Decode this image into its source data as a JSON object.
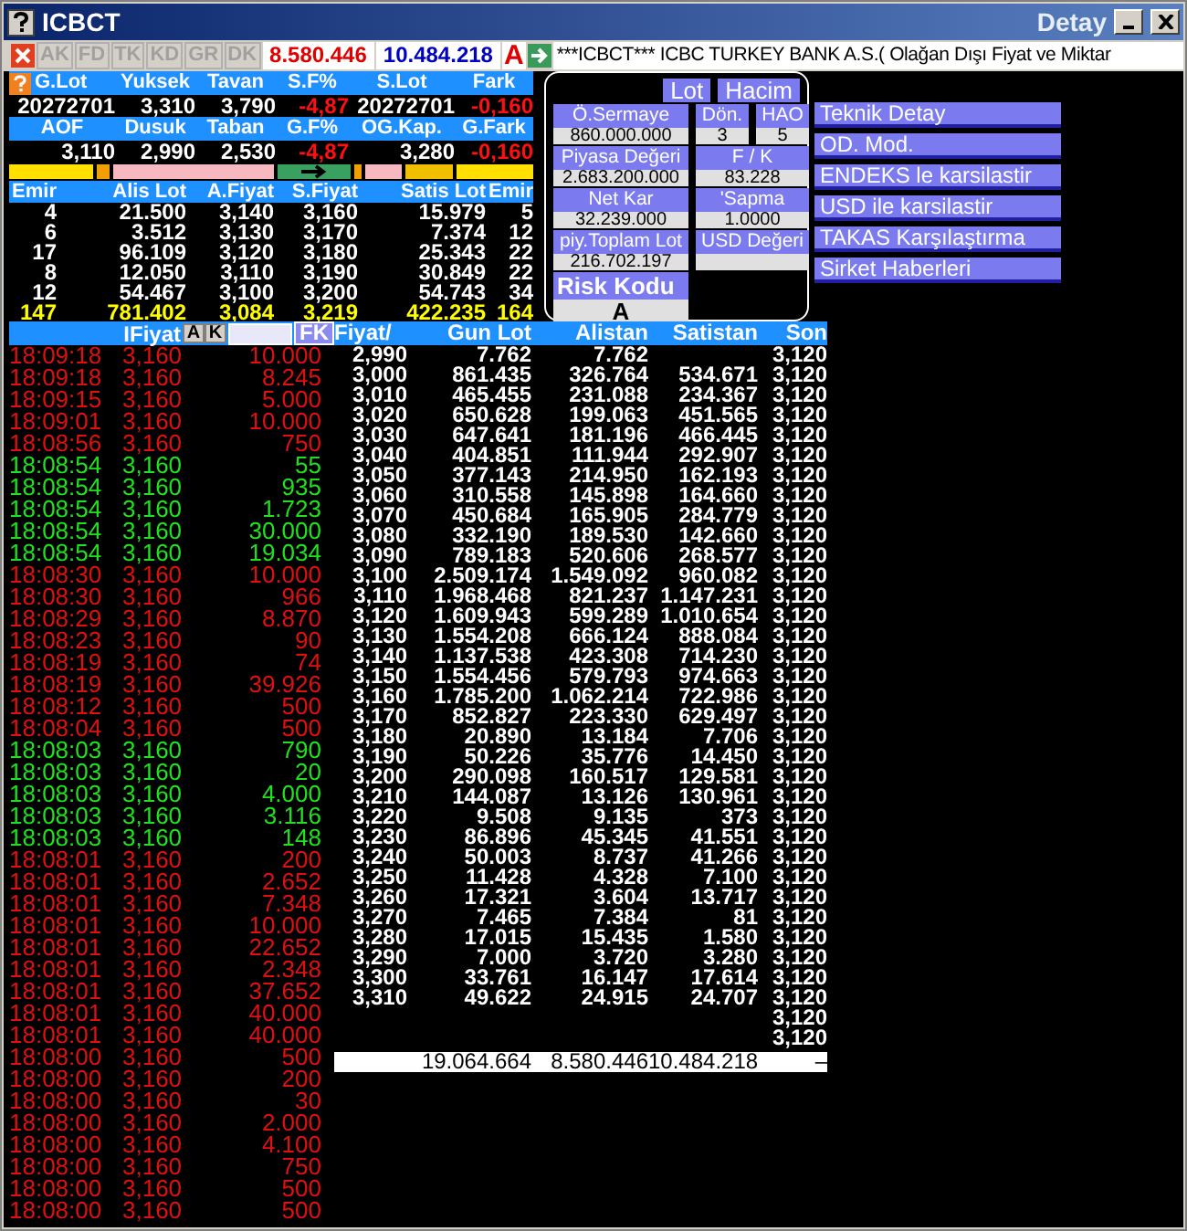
{
  "window": {
    "title": "ICBCT",
    "detail_label": "Detay"
  },
  "toolbar": {
    "buttons": [
      {
        "label": "AK",
        "disabled": true
      },
      {
        "label": "FD",
        "disabled": true
      },
      {
        "label": "TK",
        "disabled": true
      },
      {
        "label": "KD",
        "disabled": true
      },
      {
        "label": "GR",
        "disabled": true
      },
      {
        "label": "DK",
        "disabled": true
      }
    ],
    "bid_total": "8.580.446",
    "ask_total": "10.484.218",
    "flag": "A",
    "ticker": "***ICBCT*** ICBC TURKEY BANK A.S.( Olağan Dışı Fiyat ve Miktar"
  },
  "summary": [
    {
      "columns": [
        "G.Lot",
        "Yuksek",
        "Tavan",
        "S.F%",
        "S.Lot",
        "Fark"
      ],
      "values": [
        {
          "text": "20272701",
          "negative": false
        },
        {
          "text": "3,310",
          "negative": false
        },
        {
          "text": "3,790",
          "negative": false
        },
        {
          "text": "-4,87",
          "negative": true
        },
        {
          "text": "20272701",
          "negative": false
        },
        {
          "text": "-0,160",
          "negative": true
        }
      ]
    },
    {
      "columns": [
        "AOF",
        "Dusuk",
        "Taban",
        "G.F%",
        "OG.Kap.",
        "G.Fark"
      ],
      "values": [
        {
          "text": "3,110",
          "negative": false
        },
        {
          "text": "2,990",
          "negative": false
        },
        {
          "text": "2,530",
          "negative": false
        },
        {
          "text": "-4,87",
          "negative": true
        },
        {
          "text": "3,280",
          "negative": false
        },
        {
          "text": "-0,160",
          "negative": true
        }
      ]
    }
  ],
  "order_book": {
    "columns": [
      "Emir",
      "Alis Lot",
      "A.Fiyat",
      "S.Fiyat",
      "Satis Lot",
      "Emir"
    ],
    "rows": [
      [
        "4",
        "21.500",
        "3,140",
        "3,160",
        "15.979",
        "5"
      ],
      [
        "6",
        "3.512",
        "3,130",
        "3,170",
        "7.374",
        "12"
      ],
      [
        "17",
        "96.109",
        "3,120",
        "3,180",
        "25.343",
        "22"
      ],
      [
        "8",
        "12.050",
        "3,110",
        "3,190",
        "30.849",
        "22"
      ],
      [
        "12",
        "54.467",
        "3,100",
        "3,200",
        "54.743",
        "34"
      ]
    ],
    "totals": [
      "147",
      "781.402",
      "3,084",
      "3,219",
      "422.235",
      "164"
    ]
  },
  "info_panel": {
    "mode_buttons": [
      "Lot",
      "Hacim"
    ],
    "fields": [
      {
        "label": "Ö.Sermaye",
        "value": "860.000.000",
        "kind": "wide"
      },
      {
        "label": "Dön.",
        "value": "3",
        "kind": "narrow"
      },
      {
        "label": "HAO",
        "value": "5",
        "kind": "narrow"
      },
      {
        "label": "Piyasa Değeri",
        "value": "2.683.200.000",
        "kind": "wide"
      },
      {
        "label": "F / K",
        "value": "83.228",
        "kind": "pair"
      },
      {
        "label": "Net Kar",
        "value": "32.239.000",
        "kind": "wide"
      },
      {
        "label": "'Sapma",
        "value": "1.0000",
        "kind": "pair"
      },
      {
        "label": "piy.Toplam Lot",
        "value": "216.702.197",
        "kind": "wide"
      },
      {
        "label": "USD Değeri",
        "kind": "pair"
      }
    ],
    "risk": {
      "label": "Risk Kodu",
      "value": "A"
    }
  },
  "actions": [
    "Teknik Detay",
    "OD. Mod.",
    "ENDEKS le karsilastir",
    "USD ile karsilastir",
    "TAKAS Karşılaştırma",
    "Sirket Haberleri"
  ],
  "trades": {
    "header": "IFiyat",
    "buttons": [
      "A",
      "K"
    ],
    "fk_label": "FK",
    "rows": [
      {
        "time": "18:09:18",
        "price": "3,160",
        "lot": "10.000",
        "buy": false
      },
      {
        "time": "18:09:18",
        "price": "3,160",
        "lot": "8.245",
        "buy": false
      },
      {
        "time": "18:09:15",
        "price": "3,160",
        "lot": "5.000",
        "buy": false
      },
      {
        "time": "18:09:01",
        "price": "3,160",
        "lot": "10.000",
        "buy": false
      },
      {
        "time": "18:08:56",
        "price": "3,160",
        "lot": "750",
        "buy": false
      },
      {
        "time": "18:08:54",
        "price": "3,160",
        "lot": "55",
        "buy": true
      },
      {
        "time": "18:08:54",
        "price": "3,160",
        "lot": "935",
        "buy": true
      },
      {
        "time": "18:08:54",
        "price": "3,160",
        "lot": "1.723",
        "buy": true
      },
      {
        "time": "18:08:54",
        "price": "3,160",
        "lot": "30.000",
        "buy": true
      },
      {
        "time": "18:08:54",
        "price": "3,160",
        "lot": "19.034",
        "buy": true
      },
      {
        "time": "18:08:30",
        "price": "3,160",
        "lot": "10.000",
        "buy": false
      },
      {
        "time": "18:08:30",
        "price": "3,160",
        "lot": "966",
        "buy": false
      },
      {
        "time": "18:08:29",
        "price": "3,160",
        "lot": "8.870",
        "buy": false
      },
      {
        "time": "18:08:23",
        "price": "3,160",
        "lot": "90",
        "buy": false
      },
      {
        "time": "18:08:19",
        "price": "3,160",
        "lot": "74",
        "buy": false
      },
      {
        "time": "18:08:19",
        "price": "3,160",
        "lot": "39.926",
        "buy": false
      },
      {
        "time": "18:08:12",
        "price": "3,160",
        "lot": "500",
        "buy": false
      },
      {
        "time": "18:08:04",
        "price": "3,160",
        "lot": "500",
        "buy": false
      },
      {
        "time": "18:08:03",
        "price": "3,160",
        "lot": "790",
        "buy": true
      },
      {
        "time": "18:08:03",
        "price": "3,160",
        "lot": "20",
        "buy": true
      },
      {
        "time": "18:08:03",
        "price": "3,160",
        "lot": "4.000",
        "buy": true
      },
      {
        "time": "18:08:03",
        "price": "3,160",
        "lot": "3.116",
        "buy": true
      },
      {
        "time": "18:08:03",
        "price": "3,160",
        "lot": "148",
        "buy": true
      },
      {
        "time": "18:08:01",
        "price": "3,160",
        "lot": "200",
        "buy": false
      },
      {
        "time": "18:08:01",
        "price": "3,160",
        "lot": "2.652",
        "buy": false
      },
      {
        "time": "18:08:01",
        "price": "3,160",
        "lot": "7.348",
        "buy": false
      },
      {
        "time": "18:08:01",
        "price": "3,160",
        "lot": "10.000",
        "buy": false
      },
      {
        "time": "18:08:01",
        "price": "3,160",
        "lot": "22.652",
        "buy": false
      },
      {
        "time": "18:08:01",
        "price": "3,160",
        "lot": "2.348",
        "buy": false
      },
      {
        "time": "18:08:01",
        "price": "3,160",
        "lot": "37.652",
        "buy": false
      },
      {
        "time": "18:08:01",
        "price": "3,160",
        "lot": "40.000",
        "buy": false
      },
      {
        "time": "18:08:01",
        "price": "3,160",
        "lot": "40.000",
        "buy": false
      },
      {
        "time": "18:08:00",
        "price": "3,160",
        "lot": "500",
        "buy": false
      },
      {
        "time": "18:08:00",
        "price": "3,160",
        "lot": "200",
        "buy": false
      },
      {
        "time": "18:08:00",
        "price": "3,160",
        "lot": "30",
        "buy": false
      },
      {
        "time": "18:08:00",
        "price": "3,160",
        "lot": "2.000",
        "buy": false
      },
      {
        "time": "18:08:00",
        "price": "3,160",
        "lot": "4.100",
        "buy": false
      },
      {
        "time": "18:08:00",
        "price": "3,160",
        "lot": "750",
        "buy": false
      },
      {
        "time": "18:08:00",
        "price": "3,160",
        "lot": "500",
        "buy": false
      },
      {
        "time": "18:08:00",
        "price": "3,160",
        "lot": "500",
        "buy": false
      }
    ]
  },
  "price_table": {
    "columns": [
      "Fiyat/",
      "Gun Lot",
      "Alistan",
      "Satistan",
      "Son"
    ],
    "rows": [
      [
        "2,990",
        "7.762",
        "7.762",
        null,
        "3,120"
      ],
      [
        "3,000",
        "861.435",
        "326.764",
        "534.671",
        "3,120"
      ],
      [
        "3,010",
        "465.455",
        "231.088",
        "234.367",
        "3,120"
      ],
      [
        "3,020",
        "650.628",
        "199.063",
        "451.565",
        "3,120"
      ],
      [
        "3,030",
        "647.641",
        "181.196",
        "466.445",
        "3,120"
      ],
      [
        "3,040",
        "404.851",
        "111.944",
        "292.907",
        "3,120"
      ],
      [
        "3,050",
        "377.143",
        "214.950",
        "162.193",
        "3,120"
      ],
      [
        "3,060",
        "310.558",
        "145.898",
        "164.660",
        "3,120"
      ],
      [
        "3,070",
        "450.684",
        "165.905",
        "284.779",
        "3,120"
      ],
      [
        "3,080",
        "332.190",
        "189.530",
        "142.660",
        "3,120"
      ],
      [
        "3,090",
        "789.183",
        "520.606",
        "268.577",
        "3,120"
      ],
      [
        "3,100",
        "2.509.174",
        "1.549.092",
        "960.082",
        "3,120"
      ],
      [
        "3,110",
        "1.968.468",
        "821.237",
        "1.147.231",
        "3,120"
      ],
      [
        "3,120",
        "1.609.943",
        "599.289",
        "1.010.654",
        "3,120"
      ],
      [
        "3,130",
        "1.554.208",
        "666.124",
        "888.084",
        "3,120"
      ],
      [
        "3,140",
        "1.137.538",
        "423.308",
        "714.230",
        "3,120"
      ],
      [
        "3,150",
        "1.554.456",
        "579.793",
        "974.663",
        "3,120"
      ],
      [
        "3,160",
        "1.785.200",
        "1.062.214",
        "722.986",
        "3,120"
      ],
      [
        "3,170",
        "852.827",
        "223.330",
        "629.497",
        "3,120"
      ],
      [
        "3,180",
        "20.890",
        "13.184",
        "7.706",
        "3,120"
      ],
      [
        "3,190",
        "50.226",
        "35.776",
        "14.450",
        "3,120"
      ],
      [
        "3,200",
        "290.098",
        "160.517",
        "129.581",
        "3,120"
      ],
      [
        "3,210",
        "144.087",
        "13.126",
        "130.961",
        "3,120"
      ],
      [
        "3,220",
        "9.508",
        "9.135",
        "373",
        "3,120"
      ],
      [
        "3,230",
        "86.896",
        "45.345",
        "41.551",
        "3,120"
      ],
      [
        "3,240",
        "50.003",
        "8.737",
        "41.266",
        "3,120"
      ],
      [
        "3,250",
        "11.428",
        "4.328",
        "7.100",
        "3,120"
      ],
      [
        "3,260",
        "17.321",
        "3.604",
        "13.717",
        "3,120"
      ],
      [
        "3,270",
        "7.465",
        "7.384",
        "81",
        "3,120"
      ],
      [
        "3,280",
        "17.015",
        "15.435",
        "1.580",
        "3,120"
      ],
      [
        "3,290",
        "7.000",
        "3.720",
        "3.280",
        "3,120"
      ],
      [
        "3,300",
        "33.761",
        "16.147",
        "17.614",
        "3,120"
      ],
      [
        "3,310",
        "49.622",
        "24.915",
        "24.707",
        "3,120"
      ],
      [
        null,
        null,
        null,
        null,
        "3,120"
      ],
      [
        null,
        null,
        null,
        null,
        "3,120"
      ]
    ],
    "totals": [
      "19.064.664",
      "8.580.446",
      "10.484.218",
      "–"
    ]
  }
}
